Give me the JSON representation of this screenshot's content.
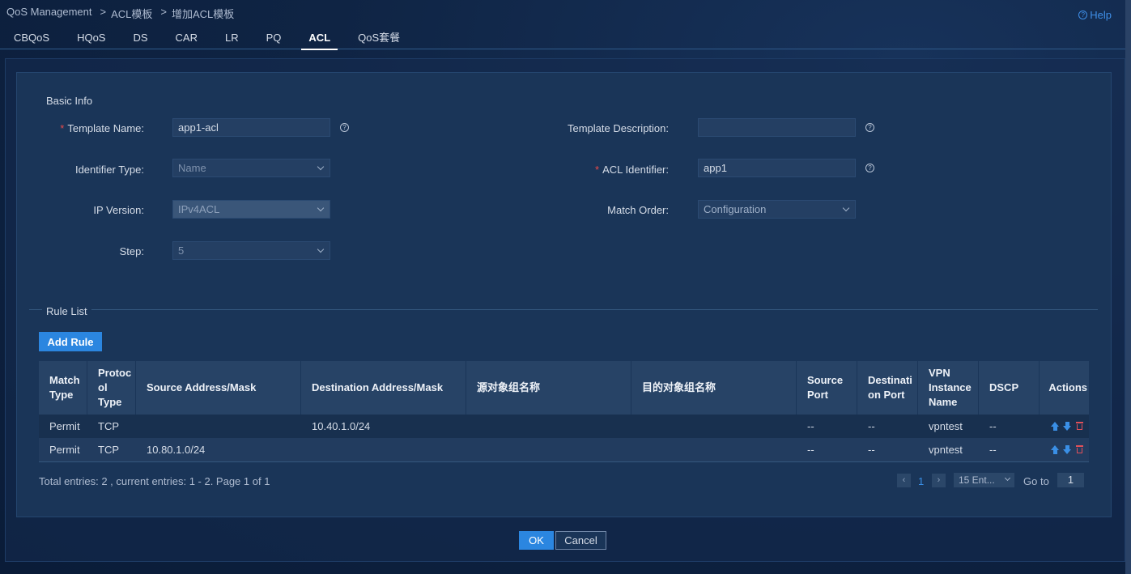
{
  "breadcrumb": [
    "QoS Management",
    "ACL模板",
    "增加ACL模板"
  ],
  "help_label": "Help",
  "tabs": [
    {
      "label": "CBQoS"
    },
    {
      "label": "HQoS"
    },
    {
      "label": "DS"
    },
    {
      "label": "CAR"
    },
    {
      "label": "LR"
    },
    {
      "label": "PQ"
    },
    {
      "label": "ACL",
      "active": true
    },
    {
      "label": "QoS套餐"
    }
  ],
  "basic_info": {
    "title": "Basic Info",
    "template_name_label": "Template Name:",
    "template_name_value": "app1-acl",
    "template_description_label": "Template Description:",
    "template_description_value": "",
    "identifier_type_label": "Identifier Type:",
    "identifier_type_value": "Name",
    "acl_identifier_label": "ACL Identifier:",
    "acl_identifier_value": "app1",
    "ip_version_label": "IP Version:",
    "ip_version_value": "IPv4ACL",
    "match_order_label": "Match Order:",
    "match_order_value": "Configuration",
    "step_label": "Step:",
    "step_value": "5"
  },
  "rule_list": {
    "title": "Rule List",
    "add_button": "Add Rule",
    "columns": [
      "Match Type",
      "Protocol Type",
      "Source Address/Mask",
      "Destination Address/Mask",
      "源对象组名称",
      "目的对象组名称",
      "Source Port",
      "Destination Port",
      "VPN Instance Name",
      "DSCP",
      "Actions"
    ],
    "header_lines": [
      [
        "Match",
        "Type"
      ],
      [
        "Protoc",
        "ol Type"
      ],
      [
        "Source Address/Mask"
      ],
      [
        "Destination Address/Mask"
      ],
      [
        "源对象组名称"
      ],
      [
        "目的对象组名称"
      ],
      [
        "Source",
        "Port"
      ],
      [
        "Destinati",
        "on Port"
      ],
      [
        "VPN",
        "Instance",
        "Name"
      ],
      [
        "DSCP"
      ],
      [
        "Actions"
      ]
    ],
    "rows": [
      [
        "Permit",
        "TCP",
        "",
        "10.40.1.0/24",
        "",
        "",
        "--",
        "--",
        "vpntest",
        "--"
      ],
      [
        "Permit",
        "TCP",
        "10.80.1.0/24",
        "",
        "",
        "",
        "--",
        "--",
        "vpntest",
        "--"
      ]
    ]
  },
  "footer": {
    "summary": "Total entries: 2 , current entries: 1 - 2. Page 1 of 1",
    "prev": "‹",
    "page": "1",
    "next": "›",
    "page_size": "15 Ent...",
    "goto_label": "Go to",
    "goto_value": "1"
  },
  "ok_button": "OK",
  "cancel_button": "Cancel",
  "colors": {
    "accent": "#2b86e0",
    "required": "#e84a4a",
    "delete": "#e0505a"
  }
}
